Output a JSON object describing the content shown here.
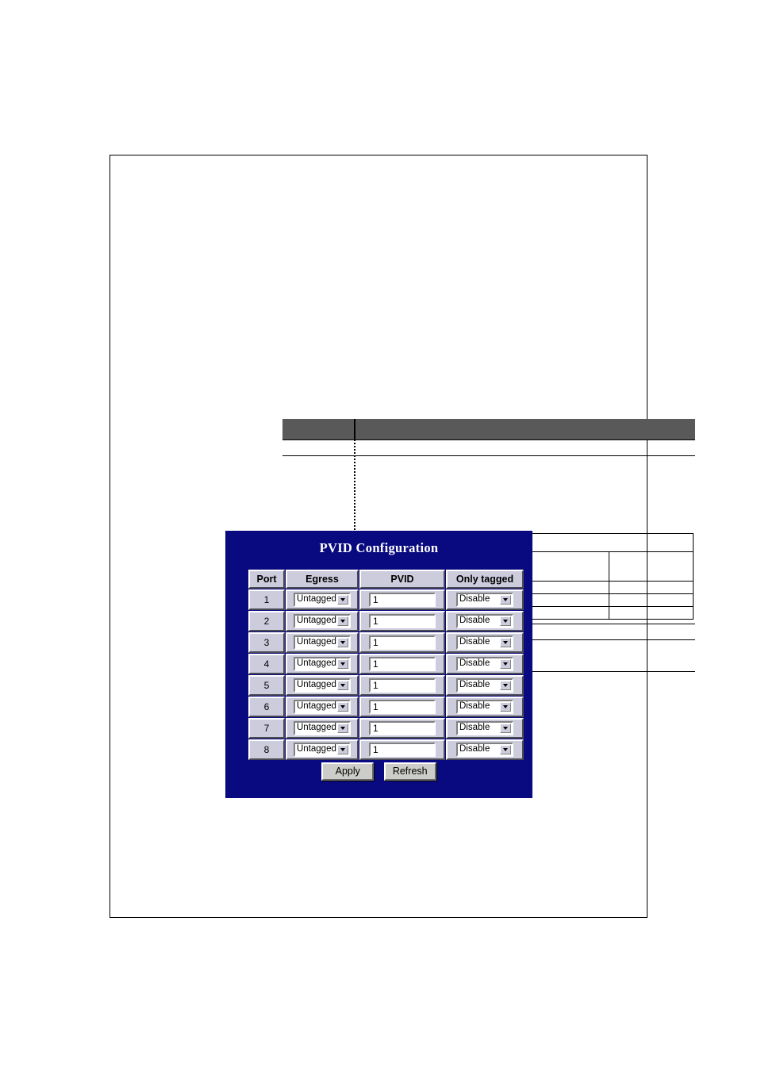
{
  "document": {
    "header_bar": {
      "left_cell": "",
      "right_cell": ""
    },
    "nested_table": {
      "header_row": [
        "",
        ""
      ],
      "rows": [
        [
          "",
          "",
          "",
          ""
        ],
        [
          "",
          "",
          "",
          ""
        ],
        [
          "",
          "",
          "",
          ""
        ],
        [
          "",
          "",
          "",
          ""
        ]
      ]
    }
  },
  "pvid_panel": {
    "title": "PVID Configuration",
    "background_color": "#0a0a80",
    "table_background_color": "#ccccdd",
    "columns": [
      "Port",
      "Egress",
      "PVID",
      "Only tagged"
    ],
    "rows": [
      {
        "port": "1",
        "egress": "Untagged",
        "pvid": "1",
        "only_tagged": "Disable"
      },
      {
        "port": "2",
        "egress": "Untagged",
        "pvid": "1",
        "only_tagged": "Disable"
      },
      {
        "port": "3",
        "egress": "Untagged",
        "pvid": "1",
        "only_tagged": "Disable"
      },
      {
        "port": "4",
        "egress": "Untagged",
        "pvid": "1",
        "only_tagged": "Disable"
      },
      {
        "port": "5",
        "egress": "Untagged",
        "pvid": "1",
        "only_tagged": "Disable"
      },
      {
        "port": "6",
        "egress": "Untagged",
        "pvid": "1",
        "only_tagged": "Disable"
      },
      {
        "port": "7",
        "egress": "Untagged",
        "pvid": "1",
        "only_tagged": "Disable"
      },
      {
        "port": "8",
        "egress": "Untagged",
        "pvid": "1",
        "only_tagged": "Disable"
      }
    ],
    "buttons": {
      "apply": "Apply",
      "refresh": "Refresh"
    }
  }
}
